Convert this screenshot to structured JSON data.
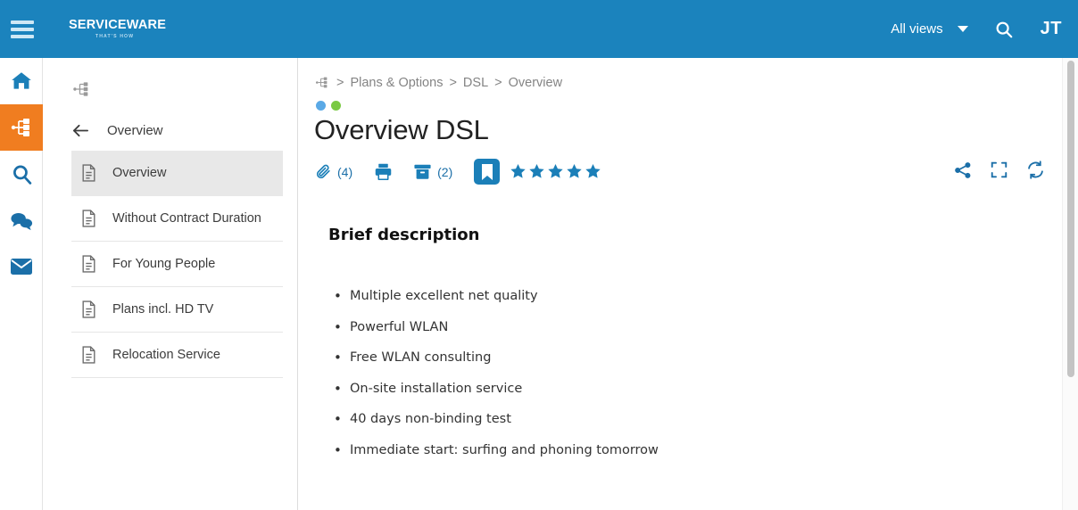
{
  "topbar": {
    "menu_icon": "hamburger-icon",
    "logo_text": "SERVICEWARE",
    "logo_tagline": "THAT'S HOW",
    "views_label": "All views",
    "search_icon": "search-icon",
    "avatar_initials": "JT"
  },
  "rail": {
    "items": [
      {
        "icon": "home-icon",
        "name": "home",
        "active": false
      },
      {
        "icon": "tree-icon",
        "name": "knowledge-tree",
        "active": true
      },
      {
        "icon": "search-icon",
        "name": "search",
        "active": false
      },
      {
        "icon": "chat-icon",
        "name": "chat",
        "active": false
      },
      {
        "icon": "envelope-icon",
        "name": "mail",
        "active": false
      }
    ]
  },
  "sidebar": {
    "tree_icon": "tree-icon",
    "back_icon": "arrow-left-icon",
    "back_label": "Overview",
    "items": [
      {
        "label": "Overview",
        "icon": "document-icon",
        "active": true
      },
      {
        "label": "Without Contract Duration",
        "icon": "document-icon",
        "active": false
      },
      {
        "label": "For Young People",
        "icon": "document-icon",
        "active": false
      },
      {
        "label": "Plans incl. HD TV",
        "icon": "document-icon",
        "active": false
      },
      {
        "label": "Relocation Service",
        "icon": "document-icon",
        "active": false
      }
    ]
  },
  "main": {
    "breadcrumb": {
      "root_icon": "tree-icon",
      "separator": ">",
      "items": [
        "Plans & Options",
        "DSL",
        "Overview"
      ]
    },
    "status_dots": [
      {
        "name": "status-dot-blue",
        "color": "#5aa9e6"
      },
      {
        "name": "status-dot-green",
        "color": "#7ac943"
      }
    ],
    "title": "Overview DSL",
    "actions": {
      "attachment_icon": "paperclip-icon",
      "attachment_count": "(4)",
      "print_icon": "printer-icon",
      "archive_icon": "archive-icon",
      "archive_count": "(2)",
      "bookmark_icon": "bookmark-icon",
      "rating_stars": 5,
      "share_icon": "share-icon",
      "fullscreen_icon": "fullscreen-icon",
      "refresh_icon": "refresh-icon"
    },
    "content": {
      "heading": "Brief description",
      "bullets": [
        "Multiple excellent net quality",
        "Powerful WLAN",
        "Free WLAN consulting",
        "On-site installation service",
        "40 days non-binding test",
        "Immediate start: surfing and phoning tomorrow"
      ]
    }
  },
  "colors": {
    "header_blue": "#1b83bd",
    "accent_orange": "#f07d20",
    "icon_blue": "#1b7fb8"
  }
}
